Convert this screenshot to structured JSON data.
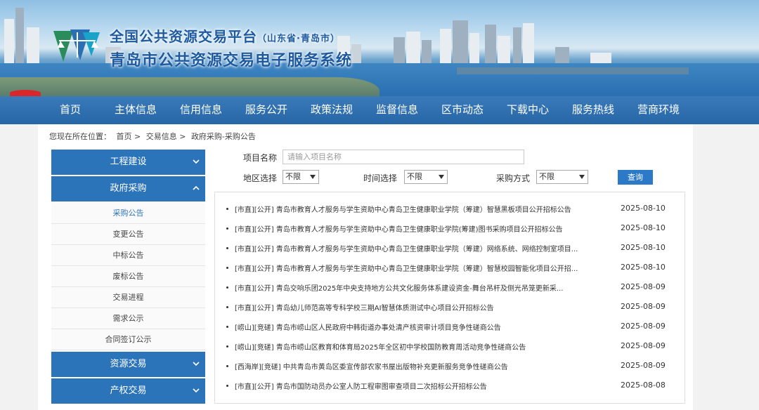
{
  "header": {
    "title_main": "全国公共资源交易平台",
    "title_region": "（山东省·青岛市）",
    "subtitle": "青岛市公共资源交易电子服务系统"
  },
  "nav": {
    "items": [
      "首页",
      "主体信息",
      "信用信息",
      "服务公开",
      "政策法规",
      "监督信息",
      "区市动态",
      "下载中心",
      "服务热线",
      "营商环境"
    ]
  },
  "breadcrumb": {
    "prefix": "您现在所在位置：",
    "items": [
      "首页",
      "交易信息",
      "政府采购-采购公告"
    ],
    "separator": ">"
  },
  "sidebar": {
    "sections": [
      {
        "label": "工程建设",
        "expanded": false
      },
      {
        "label": "政府采购",
        "expanded": true
      },
      {
        "label": "资源交易",
        "expanded": false
      },
      {
        "label": "产权交易",
        "expanded": false
      }
    ],
    "sub_items": [
      "采购公告",
      "变更公告",
      "中标公告",
      "废标公告",
      "交易进程",
      "需求公示",
      "合同签订公示"
    ],
    "active_sub": "采购公告"
  },
  "filter": {
    "project_label": "项目名称",
    "project_placeholder": "请输入项目名称",
    "region_label": "地区选择",
    "region_value": "不限",
    "time_label": "时间选择",
    "time_value": "不限",
    "method_label": "采购方式",
    "method_value": "不限",
    "search_button": "查询"
  },
  "announcements": [
    {
      "title": "[市直][公开] 青岛市教育人才服务与学生资助中心青岛卫生健康职业学院（筹建）智慧黑板项目公开招标公告",
      "date": "2025-08-10"
    },
    {
      "title": "[市直][公开] 青岛市教育人才服务与学生资助中心青岛卫生健康职业学院(筹建)图书采购项目公开招标公告",
      "date": "2025-08-10"
    },
    {
      "title": "[市直][公开] 青岛市教育人才服务与学生资助中心青岛卫生健康职业学院（筹建）网络系统、网络控制室项目...",
      "date": "2025-08-10"
    },
    {
      "title": "[市直][公开] 青岛市教育人才服务与学生资助中心青岛卫生健康职业学院（筹建）智慧校园智能化项目公开招...",
      "date": "2025-08-10"
    },
    {
      "title": "[市直][公开] 青岛交响乐团2025年中央支持地方公共文化服务体系建设资金-舞台吊杆及侧光吊笼更新采...",
      "date": "2025-08-09"
    },
    {
      "title": "[市直][公开] 青岛幼儿师范高等专科学校三期AI智慧体质测试中心项目公开招标公告",
      "date": "2025-08-09"
    },
    {
      "title": "[崂山][竞磋] 青岛市崂山区人民政府中韩街道办事处清产核资审计项目竞争性磋商公告",
      "date": "2025-08-09"
    },
    {
      "title": "[崂山][竞磋] 青岛市崂山区教育和体育局2025年全区初中学校国防教育周活动竞争性磋商公告",
      "date": "2025-08-09"
    },
    {
      "title": "[西海岸][竞磋] 中共青岛市黄岛区委宣传部农家书屋出版物补充更新服务竞争性磋商公告",
      "date": "2025-08-09"
    },
    {
      "title": "[市直][公开] 青岛市国防动员办公室人防工程审图审查项目二次招标公开招标公告",
      "date": "2025-08-08"
    }
  ],
  "colors": {
    "primary_blue": "#2c74ba",
    "nav_blue": "#2a6fb4",
    "title_blue": "#1e5aa0",
    "button_blue": "#2c79c7"
  }
}
